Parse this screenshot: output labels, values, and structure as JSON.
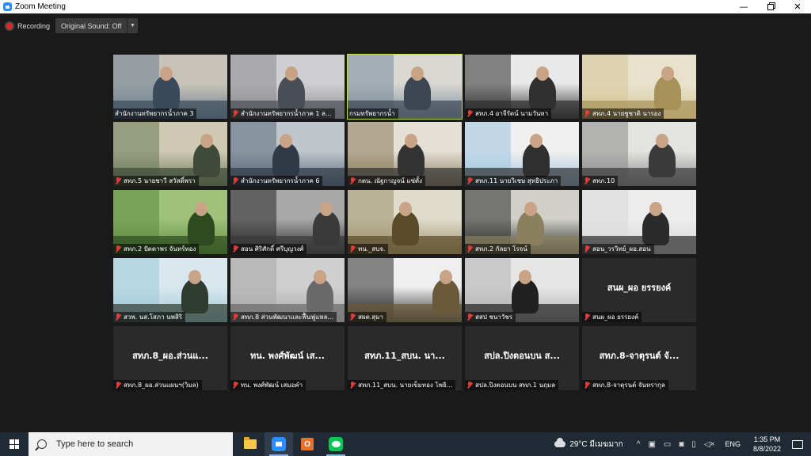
{
  "window": {
    "title": "Zoom Meeting",
    "controls": {
      "minimize": "—",
      "close": "✕"
    }
  },
  "recording": {
    "label": "Recording"
  },
  "audio": {
    "label": "Original Sound: Off",
    "caret": "▼"
  },
  "tiles": [
    {
      "name": "สำนักงานทรัพยากรน้ำภาค 3",
      "muted": false,
      "video": true
    },
    {
      "name": "สำนักงานทรัพยากรน้ำภาค 1 ล...",
      "muted": true,
      "video": true
    },
    {
      "name": "กรมทรัพยากรน้ำ",
      "muted": false,
      "video": true,
      "active": true
    },
    {
      "name": "สทภ.4 อาจีรัตน์ นามวันทา",
      "muted": true,
      "video": true
    },
    {
      "name": "สทภ.4 นายชูชาติ นารอง",
      "muted": true,
      "video": true
    },
    {
      "name": "สทภ.5 นายชาวี สวัสดิ์พรา",
      "muted": true,
      "video": true
    },
    {
      "name": "สำนักงานทรัพยากรน้ำภาค 6",
      "muted": true,
      "video": true
    },
    {
      "name": "กตน. ณัฐกาญจน์ แซ่ตั้ง",
      "muted": true,
      "video": true
    },
    {
      "name": "สทภ.11 นายวิเชษ สุทธิประภา",
      "muted": true,
      "video": true
    },
    {
      "name": "สทภ.10",
      "muted": true,
      "video": true
    },
    {
      "name": "สทภ.2 ปัตตาพร จันทร์ทอง",
      "muted": true,
      "video": true
    },
    {
      "name": "สอน ศิริศักดิ์ ศรีบุญวงศ์",
      "muted": true,
      "video": true
    },
    {
      "name": "ทน._สบจ.",
      "muted": true,
      "video": true
    },
    {
      "name": "สทภ.2 กัลยา โรจน์",
      "muted": true,
      "video": true
    },
    {
      "name": "สอน_วรวิทย์_ผอ.สอน",
      "muted": true,
      "video": true
    },
    {
      "name": "สวพ. นส.โสภา นพสิริ",
      "muted": true,
      "video": true
    },
    {
      "name": "สทภ.8 ส่วนพัฒนาและฟื้นฟูแหล...",
      "muted": true,
      "video": true
    },
    {
      "name": "สผต.สุมา",
      "muted": true,
      "video": true
    },
    {
      "name": "สสป ชนาวัชร",
      "muted": true,
      "video": true
    },
    {
      "name": "สนผ_ผอ ยรรยงค์",
      "muted": true,
      "video": false,
      "display": "สนผ_ผอ ยรรยงค์"
    },
    {
      "name": "สทภ.8_ผอ.ส่วนแผนฯ(วิมล)",
      "muted": true,
      "video": false,
      "display": "สทภ.8_ผอ.ส่วนแ..."
    },
    {
      "name": "ทน. พงศ์พัฒน์ เสมอคำ",
      "muted": true,
      "video": false,
      "display": "ทน. พงศ์พัฒน์ เส..."
    },
    {
      "name": "สทภ.11_สบน. นายเข็มทอง โพธิ...",
      "muted": true,
      "video": false,
      "display": "สทภ.11_สบน. นา..."
    },
    {
      "name": "สปล.ปิงตอนบน สทภ.1 นฤมล",
      "muted": true,
      "video": false,
      "display": "สปล.ปิงตอนบน ส..."
    },
    {
      "name": "สทภ.8-จาตุรนต์ จันทรากุล",
      "muted": true,
      "video": false,
      "display": "สทภ.8-จาตุรนต์ จั..."
    }
  ],
  "taskbar": {
    "search_placeholder": "Type here to search",
    "weather": "29°C มีเมฆมาก",
    "language": "ENG",
    "time": "1:35 PM",
    "date": "8/8/2022",
    "tray_chevron": "^"
  }
}
